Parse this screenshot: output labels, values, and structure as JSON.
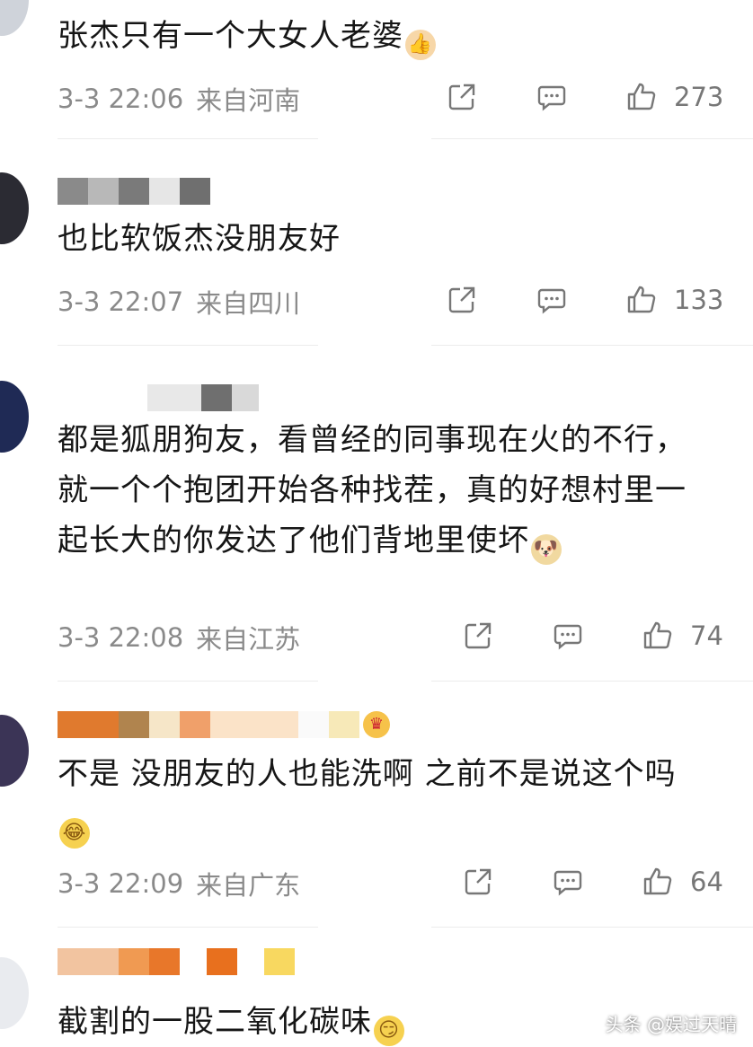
{
  "comments": [
    {
      "text": "张杰只有一个大女人老婆",
      "emoji": "thumbs-up",
      "time": "3-3 22:06",
      "location": "来自河南",
      "likes": "273"
    },
    {
      "text": "也比软饭杰没朋友好",
      "time": "3-3 22:07",
      "location": "来自四川",
      "likes": "133"
    },
    {
      "text": "都是狐朋狗友，看曾经的同事现在火的不行，就一个个抱团开始各种找茬，真的好想村里一起长大的你发达了他们背地里使坏",
      "emoji": "doge",
      "time": "3-3 22:08",
      "location": "来自江苏",
      "likes": "74"
    },
    {
      "text": "不是 没朋友的人也能洗啊 之前不是说这个吗",
      "emoji": "laughing-tears",
      "time": "3-3 22:09",
      "location": "来自广东",
      "likes": "64"
    },
    {
      "text": "截割的一股二氧化碳味",
      "emoji": "smirk"
    }
  ],
  "watermark": "头条 @娱过天晴",
  "icons": {
    "share": "share-icon",
    "reply": "comment-icon",
    "like": "thumbs-up-icon"
  }
}
